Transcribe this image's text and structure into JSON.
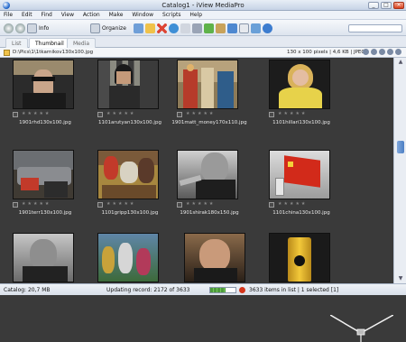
{
  "window": {
    "title": "Catalog1 - iView MediaPro",
    "min": "_",
    "max": "□",
    "close": "×"
  },
  "menu": [
    "File",
    "Edit",
    "Find",
    "View",
    "Action",
    "Make",
    "Window",
    "Scripts",
    "Help"
  ],
  "toolbar": {
    "info_label": "Info",
    "organize_label": "Organize"
  },
  "tabs": [
    {
      "label": "List",
      "active": false
    },
    {
      "label": "Thumbnail",
      "active": true
    },
    {
      "label": "Media",
      "active": false
    }
  ],
  "pathbar": {
    "path": "D:\\Pics\\1\\1tkarnikov130x100.jpg",
    "info": "130 x 100 pixels  |  4,6 KB  |  JPEG"
  },
  "items": [
    {
      "filename": "1901rhd130x100.jpg"
    },
    {
      "filename": "1101arutyan130x100.jpg"
    },
    {
      "filename": "1901matt_money170x110.jpg"
    },
    {
      "filename": "1101hillari130x100.jpg"
    },
    {
      "filename": "1901terr130x100.jpg"
    },
    {
      "filename": "1101gripp130x100.jpg"
    },
    {
      "filename": "1901shirak180x150.jpg"
    },
    {
      "filename": "1101china130x100.jpg"
    },
    {
      "filename": ""
    },
    {
      "filename": ""
    },
    {
      "filename": ""
    },
    {
      "filename": ""
    }
  ],
  "status": {
    "catalog": "Catalog: 20,7 MB",
    "updating": "Updating record: 2172 of 3633",
    "progress": 0.6,
    "items": "3633 items in list  |  1 selected [1]"
  },
  "colors": {
    "accent": "#2a6fd1",
    "grid_bg": "#3a3a3a",
    "stop": "#d5361c",
    "progress": "#4d9a3c"
  }
}
